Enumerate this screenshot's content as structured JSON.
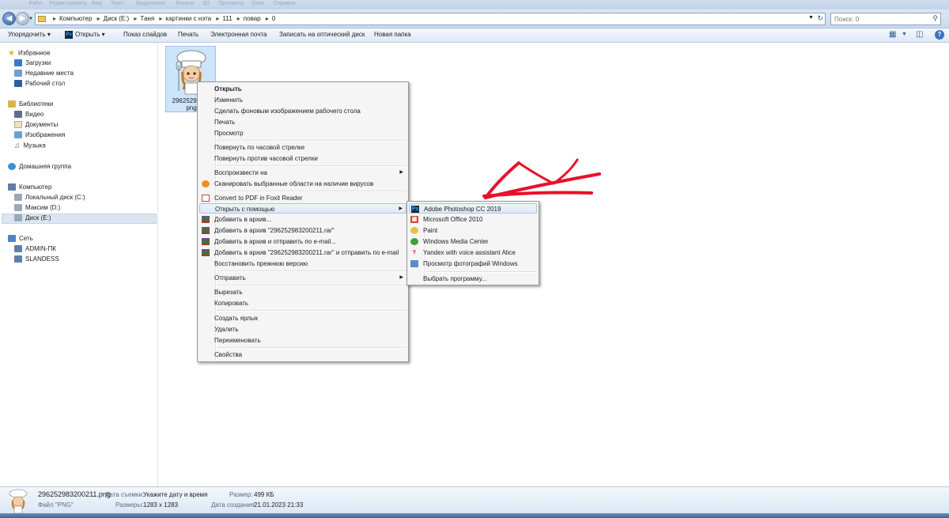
{
  "menubar": {
    "items": [
      "Файл",
      "Редактировать",
      "Вид",
      "Текст",
      "Выделение",
      "Фильтр",
      "3D",
      "Просмотр",
      "Окно",
      "Справка"
    ]
  },
  "addressbar": {
    "crumbs": [
      "Компьютер",
      "Диск (E:)",
      "Таня",
      "картинки с нэта",
      "111",
      "повар",
      "0"
    ],
    "search_placeholder": "Поиск: 0"
  },
  "toolbar": {
    "organize": "Упорядочить ▾",
    "open": "Открыть ▾",
    "slideshow": "Показ слайдов",
    "print": "Печать",
    "email": "Электронная почта",
    "burn": "Записать на оптический диск",
    "new_folder": "Новая папка"
  },
  "navpane": {
    "favorites": "Избранное",
    "downloads": "Загрузки",
    "recent": "Недавние места",
    "desktop": "Рабочий стол",
    "libraries": "Библиотеки",
    "video": "Видео",
    "documents": "Документы",
    "pictures": "Изображения",
    "music": "Музыка",
    "homegroup": "Домашняя группа",
    "computer": "Компьютер",
    "drive_c": "Локальный диск (C:)",
    "drive_d": "Максим (D:)",
    "drive_e": "Диск (E:)",
    "network": "Сеть",
    "admin_pc": "ADMIN-ПК",
    "slandess": "SLANDESS"
  },
  "file": {
    "label_line1": "29625298320",
    "label_line2": "png"
  },
  "context_menu": {
    "open": "Открыть",
    "edit": "Изменить",
    "set_wallpaper": "Сделать фоновым изображением рабочего стола",
    "print": "Печать",
    "preview": "Просмотр",
    "rotate_cw": "Повернуть по часовой стрелке",
    "rotate_ccw": "Повернуть против часовой стрелки",
    "play_to": "Воспроизвести на",
    "scan": "Сканировать выбранные области на наличие вирусов",
    "convert_pdf": "Convert to PDF in Foxit Reader",
    "open_with": "Открыть с помощью",
    "add_archive": "Добавить в архив...",
    "add_to_rar": "Добавить в архив \"296252983200211.rar\"",
    "add_email": "Добавить в архив и отправить по e-mail...",
    "add_rar_email": "Добавить в архив \"296252983200211.rar\" и отправить по e-mail",
    "restore": "Восстановить прежнюю версию",
    "send_to": "Отправить",
    "cut": "Вырезать",
    "copy": "Копировать",
    "shortcut": "Создать ярлык",
    "delete": "Удалить",
    "rename": "Переименовать",
    "properties": "Свойства"
  },
  "open_with_menu": {
    "photoshop": "Adobe Photoshop CC 2019",
    "office": "Microsoft Office 2010",
    "paint": "Paint",
    "wmc": "Windows Media Center",
    "yandex": "Yandex with voice assistant Alice",
    "photo_viewer": "Просмотр фотографий Windows",
    "choose": "Выбрать программу..."
  },
  "details": {
    "filename": "296252983200211.png",
    "filetype": "Файл \"PNG\"",
    "date_taken_label": "Дата съемки:",
    "date_taken_value": "Укажите дату и время",
    "dimensions_label": "Размеры:",
    "dimensions_value": "1283 x 1283",
    "size_label": "Размер:",
    "size_value": "499 КБ",
    "created_label": "Дата создания:",
    "created_value": "21.01.2023 21:33"
  },
  "colors": {
    "selection": "#cde4fb",
    "menu_bg": "#f5f5f5",
    "annotation": "#e8102a"
  }
}
